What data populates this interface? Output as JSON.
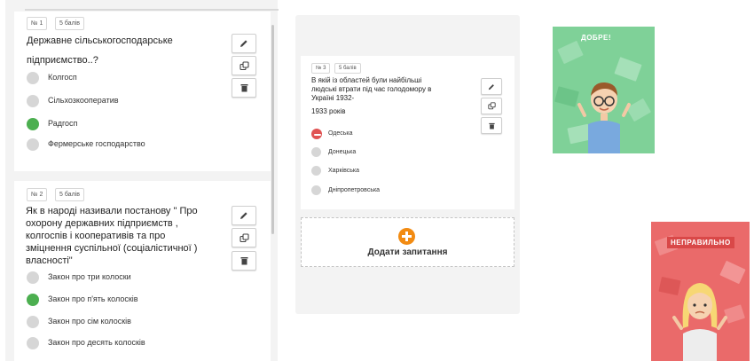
{
  "questions": [
    {
      "number": "№ 1",
      "points": "5 балів",
      "text_lines": [
        "Державне сільськогосподарське",
        "підприємство..?"
      ],
      "options": [
        {
          "label": "Колгосп",
          "state": "neutral"
        },
        {
          "label": "Сільхозкооператив",
          "state": "neutral"
        },
        {
          "label": "Радгосп",
          "state": "correct"
        },
        {
          "label": "Фермерське господарство",
          "state": "neutral"
        }
      ]
    },
    {
      "number": "№ 2",
      "points": "5 балів",
      "text_lines": [
        "Як в народі називали постанову \" Про",
        "охорону державних підприємств ,",
        "колгоспів і кооперативів та про",
        "зміцнення суспільної (соціалістичної )",
        "власності\""
      ],
      "options": [
        {
          "label": "Закон про три колоски",
          "state": "neutral"
        },
        {
          "label": "Закон про п'ять колосків",
          "state": "correct"
        },
        {
          "label": "Закон про сім колосків",
          "state": "neutral"
        },
        {
          "label": "Закон про десять колосків",
          "state": "neutral"
        }
      ]
    },
    {
      "number": "№ 3",
      "points": "5 балів",
      "text_lines": [
        "В якій із областей були найбільші",
        "людські втрати під час голодомору в",
        "Україні 1932-",
        "1933 років"
      ],
      "options": [
        {
          "label": "Одеська",
          "state": "wrong"
        },
        {
          "label": "Донецька",
          "state": "neutral"
        },
        {
          "label": "Харківська",
          "state": "neutral"
        },
        {
          "label": "Дніпропетровська",
          "state": "neutral"
        }
      ]
    }
  ],
  "actions": {
    "edit_icon": "pencil-icon",
    "duplicate_icon": "copy-icon",
    "delete_icon": "trash-icon"
  },
  "add_question": {
    "label": "Додати запитання",
    "icon": "plus-circle-icon"
  },
  "feedback": {
    "correct": {
      "label": "ДОБРЕ!",
      "color": "#7fd198"
    },
    "incorrect": {
      "label": "НЕПРАВИЛЬНО",
      "color": "#ea6a6a"
    }
  },
  "colors": {
    "correct": "#4caf50",
    "wrong": "#e05353",
    "neutral": "#d6d6d6",
    "accent": "#f28b12"
  }
}
